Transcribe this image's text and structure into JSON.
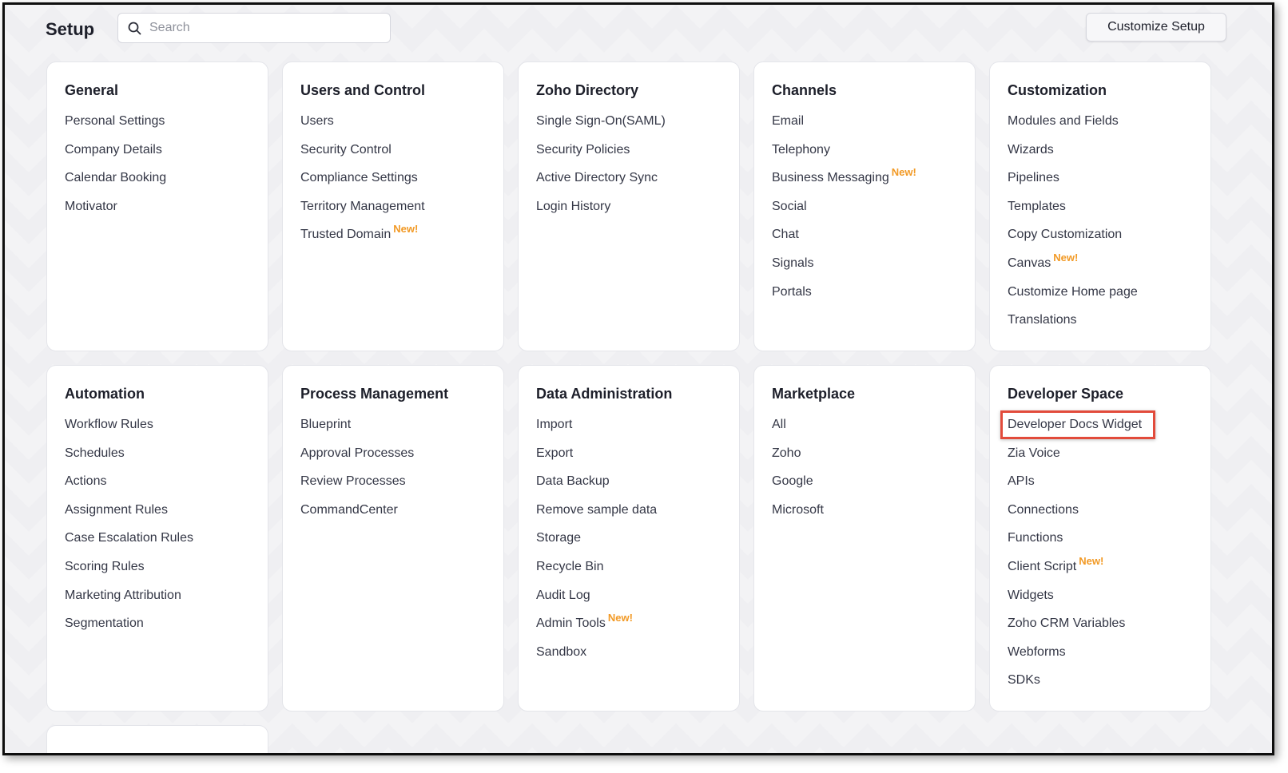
{
  "header": {
    "title": "Setup",
    "search_placeholder": "Search",
    "customize_label": "Customize Setup"
  },
  "badge_label": "New!",
  "colors": {
    "badge": "#f29a26",
    "highlight": "#e24b3b",
    "text": "#343746"
  },
  "cards": [
    {
      "title": "General",
      "items": [
        {
          "label": "Personal Settings"
        },
        {
          "label": "Company Details"
        },
        {
          "label": "Calendar Booking"
        },
        {
          "label": "Motivator"
        }
      ]
    },
    {
      "title": "Users and Control",
      "items": [
        {
          "label": "Users"
        },
        {
          "label": "Security Control"
        },
        {
          "label": "Compliance Settings"
        },
        {
          "label": "Territory Management"
        },
        {
          "label": "Trusted Domain",
          "new": true
        }
      ]
    },
    {
      "title": "Zoho Directory",
      "items": [
        {
          "label": "Single Sign-On(SAML)"
        },
        {
          "label": "Security Policies"
        },
        {
          "label": "Active Directory Sync"
        },
        {
          "label": "Login History"
        }
      ]
    },
    {
      "title": "Channels",
      "items": [
        {
          "label": "Email"
        },
        {
          "label": "Telephony"
        },
        {
          "label": "Business Messaging",
          "new": true
        },
        {
          "label": "Social"
        },
        {
          "label": "Chat"
        },
        {
          "label": "Signals"
        },
        {
          "label": "Portals"
        }
      ]
    },
    {
      "title": "Customization",
      "items": [
        {
          "label": "Modules and Fields"
        },
        {
          "label": "Wizards"
        },
        {
          "label": "Pipelines"
        },
        {
          "label": "Templates"
        },
        {
          "label": "Copy Customization"
        },
        {
          "label": "Canvas",
          "new": true
        },
        {
          "label": "Customize Home page"
        },
        {
          "label": "Translations"
        }
      ]
    },
    {
      "title": "Automation",
      "items": [
        {
          "label": "Workflow Rules"
        },
        {
          "label": "Schedules"
        },
        {
          "label": "Actions"
        },
        {
          "label": "Assignment Rules"
        },
        {
          "label": "Case Escalation Rules"
        },
        {
          "label": "Scoring Rules"
        },
        {
          "label": "Marketing Attribution"
        },
        {
          "label": "Segmentation"
        }
      ]
    },
    {
      "title": "Process Management",
      "items": [
        {
          "label": "Blueprint"
        },
        {
          "label": "Approval Processes"
        },
        {
          "label": "Review Processes"
        },
        {
          "label": "CommandCenter"
        }
      ]
    },
    {
      "title": "Data Administration",
      "items": [
        {
          "label": "Import"
        },
        {
          "label": "Export"
        },
        {
          "label": "Data Backup"
        },
        {
          "label": "Remove sample data"
        },
        {
          "label": "Storage"
        },
        {
          "label": "Recycle Bin"
        },
        {
          "label": "Audit Log"
        },
        {
          "label": "Admin Tools",
          "new": true
        },
        {
          "label": "Sandbox"
        }
      ]
    },
    {
      "title": "Marketplace",
      "items": [
        {
          "label": "All"
        },
        {
          "label": "Zoho"
        },
        {
          "label": "Google"
        },
        {
          "label": "Microsoft"
        }
      ]
    },
    {
      "title": "Developer Space",
      "items": [
        {
          "label": "Developer Docs Widget",
          "highlighted": true
        },
        {
          "label": "Zia Voice"
        },
        {
          "label": "APIs"
        },
        {
          "label": "Connections"
        },
        {
          "label": "Functions"
        },
        {
          "label": "Client Script",
          "new": true
        },
        {
          "label": "Widgets"
        },
        {
          "label": "Zoho CRM Variables"
        },
        {
          "label": "Webforms"
        },
        {
          "label": "SDKs"
        }
      ]
    }
  ]
}
